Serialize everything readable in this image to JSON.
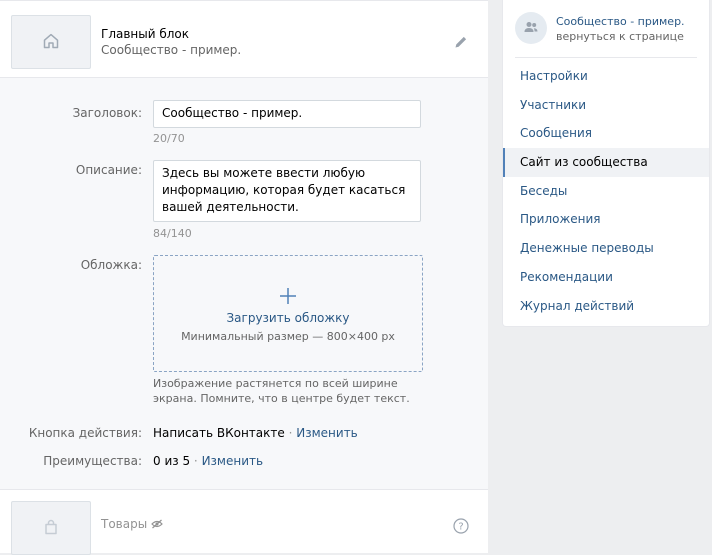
{
  "header": {
    "title": "Главный блок",
    "subtitle": "Сообщество - пример.",
    "icon": "home-icon",
    "edit_icon": "pencil-icon"
  },
  "form": {
    "title_label": "Заголовок:",
    "title_value": "Сообщество - пример.",
    "title_counter": "20/70",
    "desc_label": "Описание:",
    "desc_value": "Здесь вы можете ввести любую информацию, которая будет касаться вашей деятельности.",
    "desc_counter": "84/140",
    "cover_label": "Обложка:",
    "cover_upload_label": "Загрузить обложку",
    "cover_upload_hint": "Минимальный размер — 800×400 px",
    "cover_note": "Изображение растянется по всей ширине экрана. Помните, что в центре будет текст.",
    "action_label": "Кнопка действия:",
    "action_value": "Написать ВКонтакте",
    "action_change": "Изменить",
    "adv_label": "Преимущества:",
    "adv_value": "0 из 5",
    "adv_change": "Изменить",
    "separator": "·"
  },
  "goods": {
    "label": "Товары",
    "icon": "shopping-bag-icon",
    "hidden_icon": "eye-crossed-icon",
    "help_icon": "question-icon"
  },
  "sidebar": {
    "community_name": "Сообщество - пример.",
    "back_label": "вернуться к странице",
    "avatar_icon": "users-icon",
    "items": [
      {
        "label": "Настройки",
        "active": false
      },
      {
        "label": "Участники",
        "active": false
      },
      {
        "label": "Сообщения",
        "active": false
      },
      {
        "label": "Сайт из сообщества",
        "active": true
      },
      {
        "label": "Беседы",
        "active": false
      },
      {
        "label": "Приложения",
        "active": false
      },
      {
        "label": "Денежные переводы",
        "active": false
      },
      {
        "label": "Рекомендации",
        "active": false
      },
      {
        "label": "Журнал действий",
        "active": false
      }
    ]
  },
  "colors": {
    "link": "#2a5885",
    "accent": "#5181b8",
    "page_bg": "#edeef0",
    "panel_bg": "#f7f8fa"
  }
}
